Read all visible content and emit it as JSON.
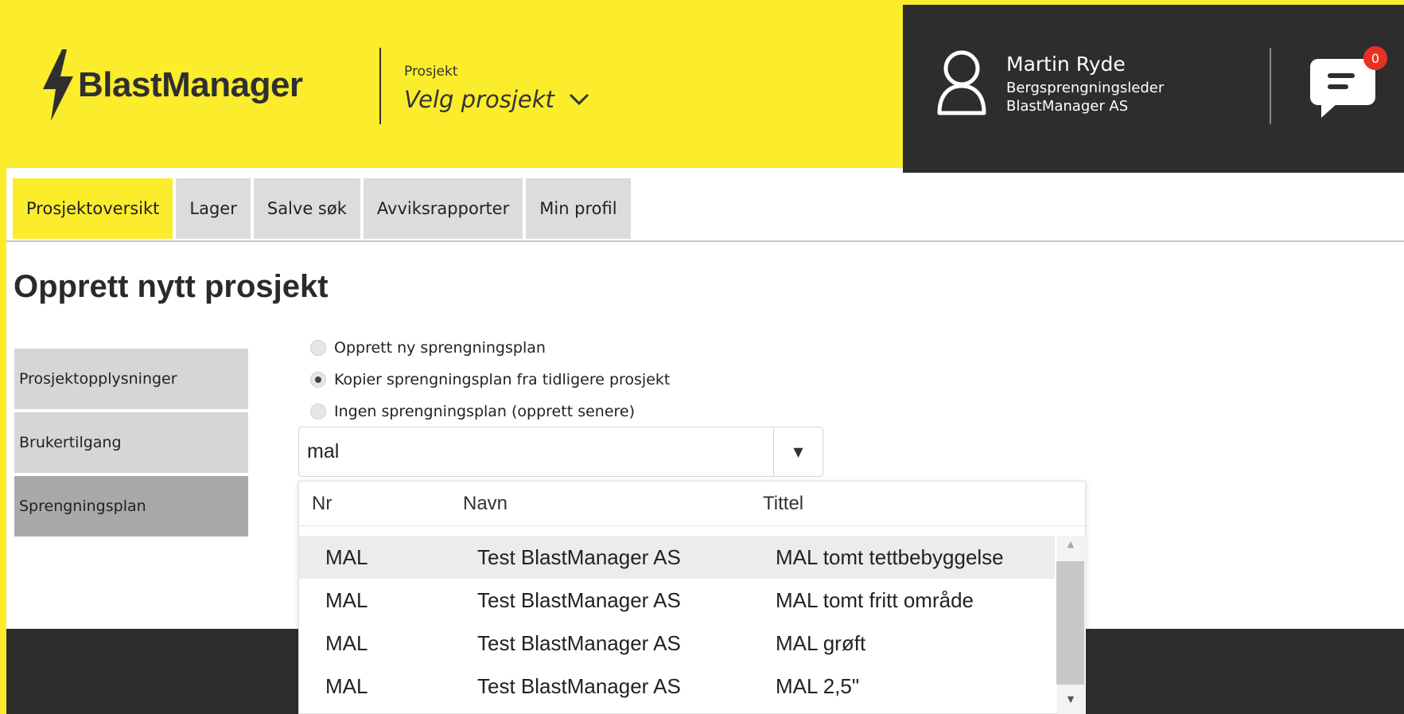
{
  "header": {
    "brand": "BlastManager",
    "project_label": "Prosjekt",
    "project_placeholder": "Velg prosjekt",
    "user": {
      "name": "Martin Ryde",
      "role": "Bergsprengningsleder",
      "company": "BlastManager AS"
    },
    "notifications_count": "0"
  },
  "nav": {
    "tabs": [
      {
        "label": "Prosjektoversikt",
        "active": true
      },
      {
        "label": "Lager"
      },
      {
        "label": "Salve søk"
      },
      {
        "label": "Avviksrapporter"
      },
      {
        "label": "Min profil"
      }
    ]
  },
  "page": {
    "title": "Opprett nytt prosjekt"
  },
  "side_menu": {
    "items": [
      {
        "label": "Prosjektopplysninger"
      },
      {
        "label": "Brukertilgang"
      },
      {
        "label": "Sprengningsplan",
        "active": true
      }
    ]
  },
  "plan_options": [
    {
      "label": "Opprett ny sprengningsplan",
      "checked": false
    },
    {
      "label": "Kopier sprengningsplan fra tidligere prosjekt",
      "checked": true
    },
    {
      "label": "Ingen sprengningsplan (opprett senere)",
      "checked": false
    }
  ],
  "combo": {
    "value": "mal",
    "arrow": "▼"
  },
  "dropdown": {
    "columns": [
      "Nr",
      "Navn",
      "Tittel"
    ],
    "rows": [
      {
        "nr": "MAL",
        "navn": "Test BlastManager AS",
        "tittel": "MAL tomt tettbebyggelse",
        "selected": true
      },
      {
        "nr": "MAL",
        "navn": "Test BlastManager AS",
        "tittel": "MAL tomt fritt område"
      },
      {
        "nr": "MAL",
        "navn": "Test BlastManager AS",
        "tittel": "MAL grøft"
      },
      {
        "nr": "MAL",
        "navn": "Test BlastManager AS",
        "tittel": "MAL 2,5\""
      }
    ]
  },
  "colors": {
    "brand_yellow": "#fbec2c",
    "header_dark": "#2d2d2d",
    "badge_red": "#e8321f"
  },
  "icons": [
    "bolt-icon",
    "chevron-down-icon",
    "user-icon",
    "chat-icon",
    "caret-down-icon",
    "scroll-up-icon",
    "scroll-down-icon"
  ]
}
